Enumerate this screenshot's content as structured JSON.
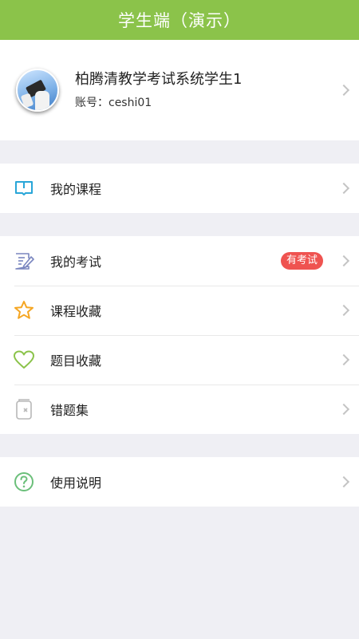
{
  "header": {
    "title": "学生端（演示）"
  },
  "profile": {
    "name": "柏腾清教学考试系统学生1",
    "account": "账号：ceshi01"
  },
  "menu": {
    "course": {
      "label": "我的课程",
      "icon": "book-icon"
    },
    "exam": {
      "label": "我的考试",
      "icon": "exam-edit-icon",
      "badge": "有考试"
    },
    "fav_course": {
      "label": "课程收藏",
      "icon": "star-icon"
    },
    "fav_question": {
      "label": "题目收藏",
      "icon": "heart-icon"
    },
    "wrong_set": {
      "label": "错题集",
      "icon": "notebook-x-icon"
    },
    "help": {
      "label": "使用说明",
      "icon": "question-circle-icon"
    }
  },
  "colors": {
    "header_bg": "#8bc34a",
    "badge_bg": "#ef5350",
    "book_icon": "#29a6d8",
    "exam_icon": "#7a86bf",
    "star_icon": "#f5a623",
    "heart_icon": "#8bc34a",
    "notebook_icon": "#b8b8b8",
    "help_icon": "#6bbf7a"
  }
}
